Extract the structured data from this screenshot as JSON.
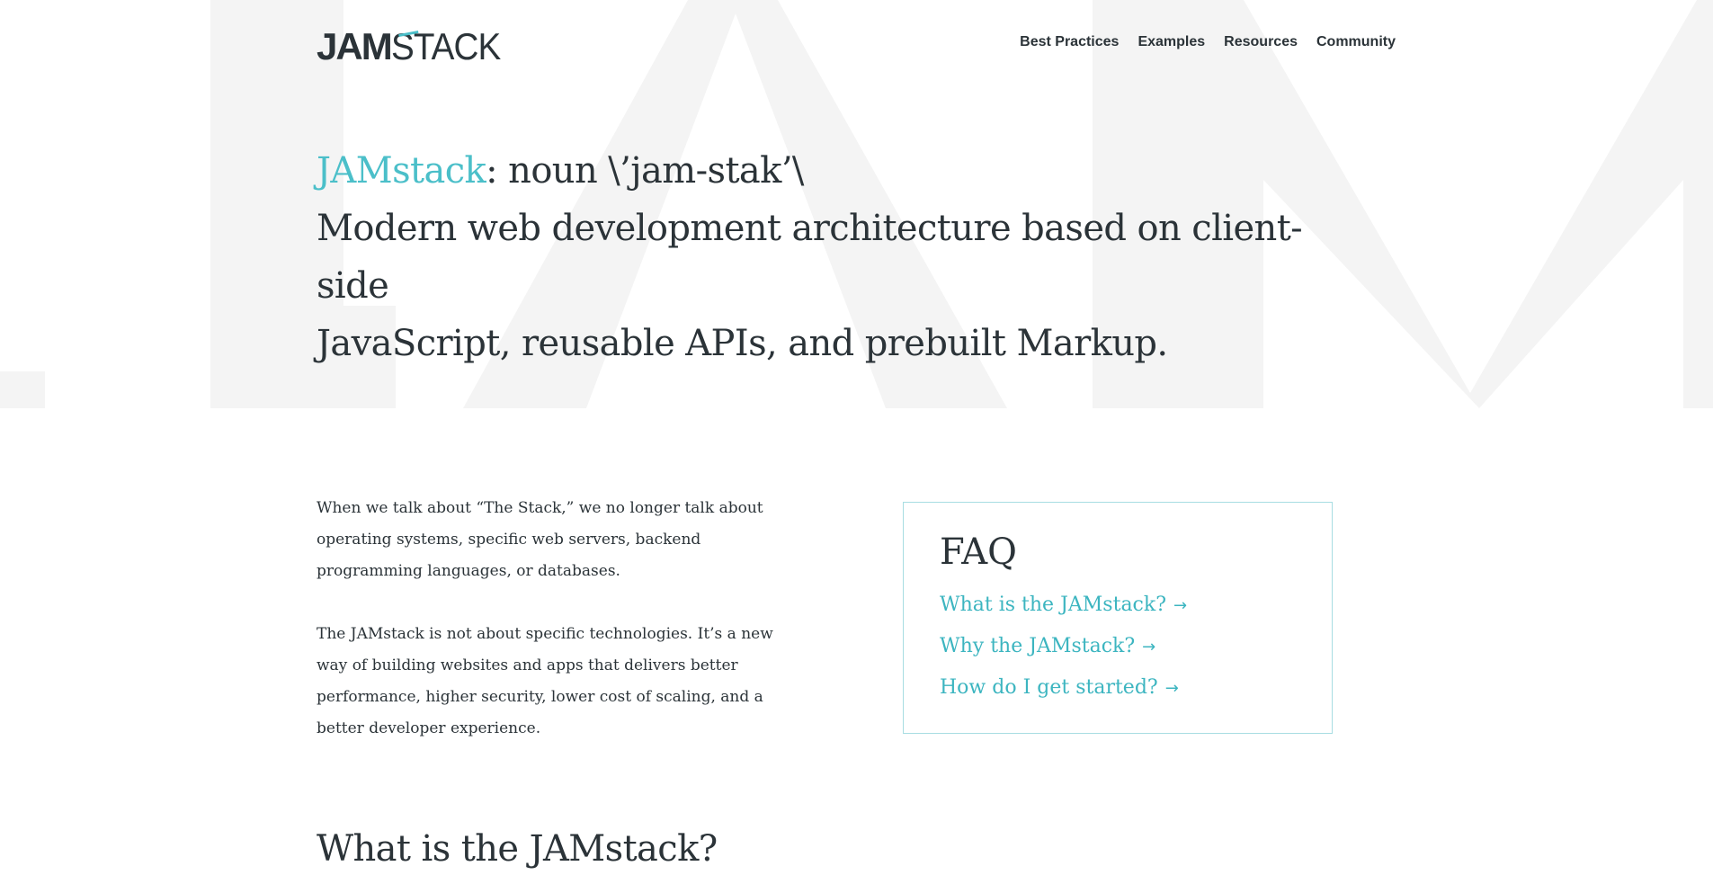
{
  "header": {
    "logo": {
      "part1": "JAM",
      "part2": "STACK"
    },
    "nav": [
      {
        "label": "Best Practices"
      },
      {
        "label": "Examples"
      },
      {
        "label": "Resources"
      },
      {
        "label": "Community"
      }
    ]
  },
  "hero": {
    "background_watermark": "JAM",
    "term": "JAMstack",
    "pronunciation": ": noun \\’jam-stak’\\",
    "line2": "Modern web development architecture based on client-side",
    "line3": "JavaScript, reusable APIs, and prebuilt Markup."
  },
  "intro": {
    "paragraph1": "When we talk about “The Stack,” we no longer talk about operating systems, specific web servers, backend programming languages, or databases.",
    "paragraph2": "The JAMstack is not about specific technologies. It’s a new way of building websites and apps that delivers better performance, higher security, lower cost of scaling, and a better developer experience."
  },
  "faq": {
    "title": "FAQ",
    "links": [
      {
        "label": "What is the JAMstack?",
        "arrow": "→"
      },
      {
        "label": "Why the JAMstack?",
        "arrow": "→"
      },
      {
        "label": "How do I get started?",
        "arrow": "→"
      }
    ]
  },
  "section": {
    "title": "What is the JAMstack?"
  },
  "colors": {
    "accent": "#4bbfc9",
    "text": "#2b3338",
    "hero_watermark": "#f4f4f4",
    "faq_border": "#a8dde2"
  }
}
